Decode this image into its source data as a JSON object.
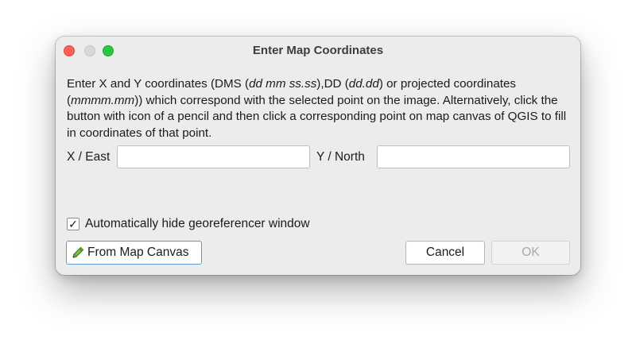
{
  "window": {
    "title": "Enter Map Coordinates"
  },
  "description": {
    "p1": "Enter X and Y coordinates (DMS (",
    "i1": "dd mm ss.ss",
    "p2": "),DD (",
    "i2": "dd.dd",
    "p3": ") or projected coordinates (",
    "i3": "mmmm.mm",
    "p4": ")) which correspond with the selected point on the image. Alternatively, click the button with icon of a pencil and then click a corresponding point on map canvas of QGIS to fill in coordinates of that point."
  },
  "fields": {
    "x_label": "X / East",
    "x_value": "",
    "y_label": "Y / North",
    "y_value": ""
  },
  "options": {
    "auto_hide_label": "Automatically hide georeferencer window",
    "auto_hide_checked": true,
    "check_glyph": "✓"
  },
  "buttons": {
    "from_map_canvas": "From Map Canvas",
    "from_map_canvas_icon": "pencil-icon",
    "cancel": "Cancel",
    "ok": "OK"
  },
  "colors": {
    "close": "#fe5f57",
    "minimize_inactive": "#d8d8d8",
    "maximize": "#28c840",
    "focus_ring": "#5c9ad6",
    "dialog_bg": "#ececec"
  }
}
